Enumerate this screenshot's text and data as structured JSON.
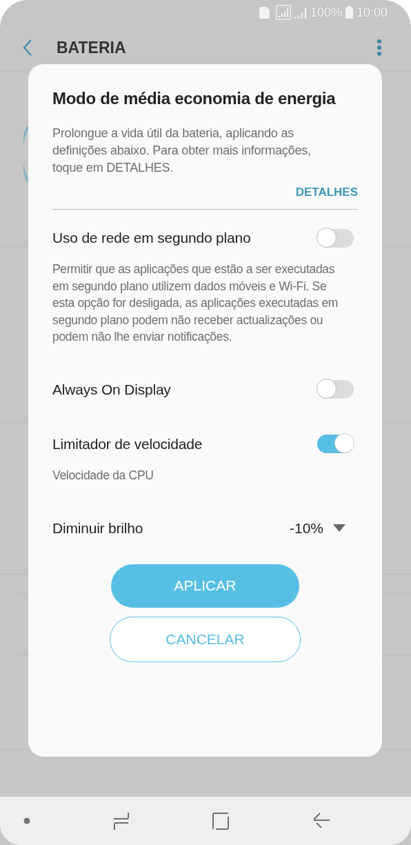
{
  "status_bar": {
    "battery": "100%",
    "time": "10:00"
  },
  "app_bar": {
    "title": "BATERIA"
  },
  "dialog": {
    "title": "Modo de média economia de energia",
    "description": "Prolongue a vida útil da bateria, aplicando as definições abaixo. Para obter mais informações, toque em DETALHES.",
    "details_link": "DETALHES",
    "options": [
      {
        "kind": "toggle",
        "label": "Uso de rede em segundo plano",
        "on": false,
        "description": "Permitir que as aplicações que estão a ser executadas em segundo plano utilizem dados móveis e Wi-Fi. Se esta opção for desligada, as aplicações executadas em segundo plano podem não receber actualizações ou podem não lhe enviar notificações."
      },
      {
        "kind": "toggle",
        "label": "Always On Display",
        "on": false
      },
      {
        "kind": "toggle",
        "label": "Limitador de velocidade",
        "on": true,
        "description": "Velocidade da CPU"
      },
      {
        "kind": "dropdown",
        "label": "Diminuir brilho",
        "value": "-10%"
      }
    ],
    "buttons": [
      {
        "kind": "primary",
        "label": "APLICAR"
      },
      {
        "kind": "outline",
        "label": "CANCELAR"
      }
    ]
  }
}
